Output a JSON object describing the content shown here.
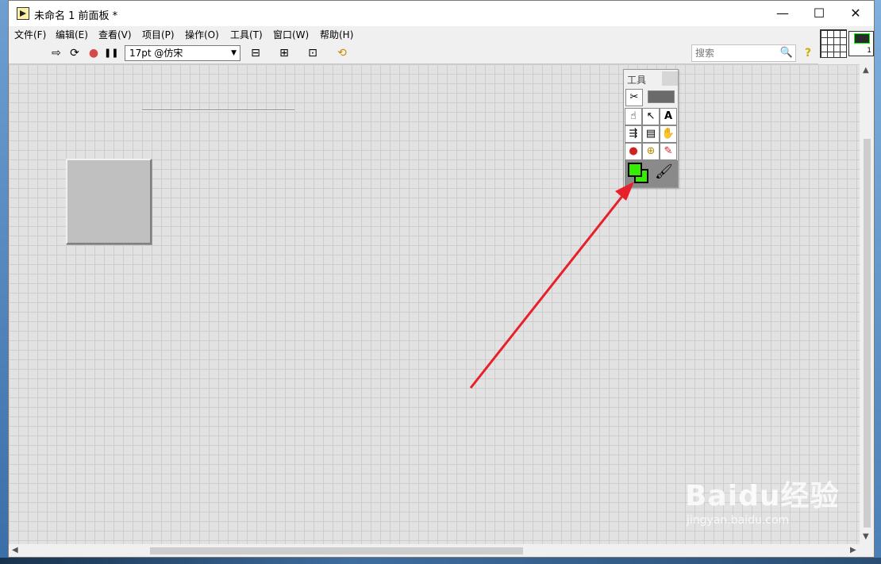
{
  "window": {
    "title": "未命名 1 前面板 *",
    "controls": {
      "minimize": "—",
      "maximize": "☐",
      "close": "✕"
    }
  },
  "menu": [
    "文件(F)",
    "编辑(E)",
    "查看(V)",
    "项目(P)",
    "操作(O)",
    "工具(T)",
    "窗口(W)",
    "帮助(H)"
  ],
  "toolbar": {
    "run": "⇨",
    "run_continuously": "⟳",
    "abort": "●",
    "pause": "❚❚",
    "font_select": "17pt @仿宋",
    "align": "⊟",
    "distribute": "⊞",
    "resize": "⊡",
    "reorder": "⟲",
    "search_placeholder": "搜索",
    "search_icon": "🔍",
    "help": "?"
  },
  "vi_icon": {
    "number": "1"
  },
  "tools_palette": {
    "title": "工具",
    "tools": [
      {
        "name": "automatic-tool",
        "glyph": "✂"
      },
      {
        "name": "operate-tool",
        "glyph": "☝"
      },
      {
        "name": "position-tool",
        "glyph": "↖"
      },
      {
        "name": "text-tool",
        "glyph": "A"
      },
      {
        "name": "wiring-tool",
        "glyph": "⇶"
      },
      {
        "name": "shortcut-menu-tool",
        "glyph": "▤"
      },
      {
        "name": "scroll-tool",
        "glyph": "✋"
      },
      {
        "name": "breakpoint-tool",
        "glyph": "●"
      },
      {
        "name": "probe-tool",
        "glyph": "⊕"
      },
      {
        "name": "get-color-tool",
        "glyph": "✎"
      }
    ],
    "set_color": {
      "foreground": "#33ee00",
      "background": "#33ee00",
      "brush_glyph": "🖌"
    }
  },
  "annotation": {
    "arrow_color": "#e8202a"
  },
  "watermark": {
    "brand_left": "Bai",
    "brand_right": "du",
    "brand_cn": "经验",
    "sub": "jingyan.baidu.com"
  }
}
